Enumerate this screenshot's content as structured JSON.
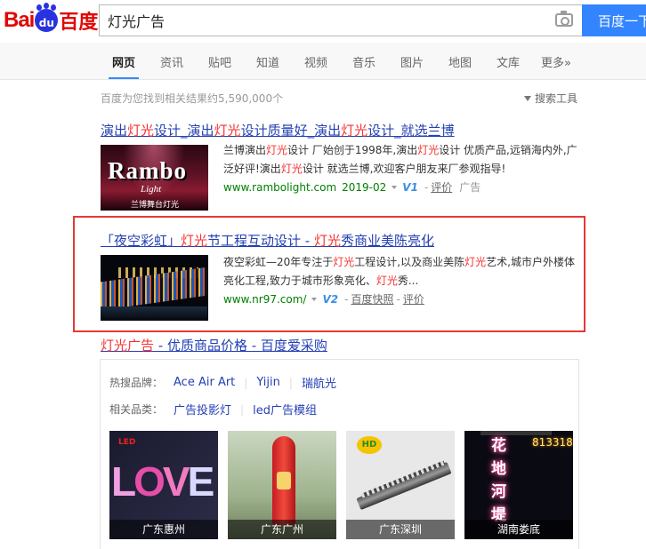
{
  "header": {
    "logo_bai": "Bai",
    "logo_du": "du",
    "logo_cn": "百度",
    "query": "灯光广告",
    "search_button": "百度一下"
  },
  "tabs": [
    "网页",
    "资讯",
    "贴吧",
    "知道",
    "视频",
    "音乐",
    "图片",
    "地图",
    "文库",
    "更多»"
  ],
  "stats": "百度为您找到相关结果约5,590,000个",
  "tools": "搜索工具",
  "results": [
    {
      "title_parts": [
        "演出",
        "灯光",
        "设计_演出",
        "灯光",
        "设计质量好_演出",
        "灯光",
        "设计_就选兰博"
      ],
      "abstract_parts": [
        "兰博演出",
        "灯光",
        "设计 厂始创于1998年,演出",
        "灯光",
        "设计 优质产品,远销海内外,广泛好评!演出",
        "灯光",
        "设计 就选兰博,欢迎客户朋友来厂参观指导!"
      ],
      "url": "www.rambolight.com",
      "date": "2019-02",
      "badge": "V1",
      "link1": "评价",
      "ad": "广告",
      "thumb": {
        "word": "Rambo",
        "light": "Light",
        "stage": "兰博舞台灯光"
      }
    },
    {
      "title_parts": [
        "「夜空彩虹」",
        "灯光",
        "节工程互动设计 - ",
        "灯光",
        "秀商业美陈亮化"
      ],
      "abstract_parts": [
        "夜空彩虹—20年专注于",
        "灯光",
        "工程设计,以及商业美陈",
        "灯光",
        "艺术,城市户外楼体亮化工程,致力于城市形象亮化、",
        "灯光",
        "秀..."
      ],
      "url": "www.nr97.com/",
      "badge": "V2",
      "link1": "百度快照",
      "link2": "评价"
    }
  ],
  "shop": {
    "title": "灯光广告 - 优质商品价格 - 百度爱采购",
    "hot_label": "热搜品牌：",
    "hot_brands": [
      "Ace Air Art",
      "Yijin",
      "瑞航光"
    ],
    "rel_label": "相关品类：",
    "rel_items": [
      "广告投影灯",
      "led广告模组"
    ],
    "products": [
      {
        "caption": "广东惠州",
        "love": [
          "L",
          "O",
          "V",
          "E"
        ]
      },
      {
        "caption": "广东广州"
      },
      {
        "caption": "广东深圳"
      },
      {
        "caption": "湖南娄底",
        "neon": "花地河堤",
        "digits": "813318"
      }
    ]
  }
}
